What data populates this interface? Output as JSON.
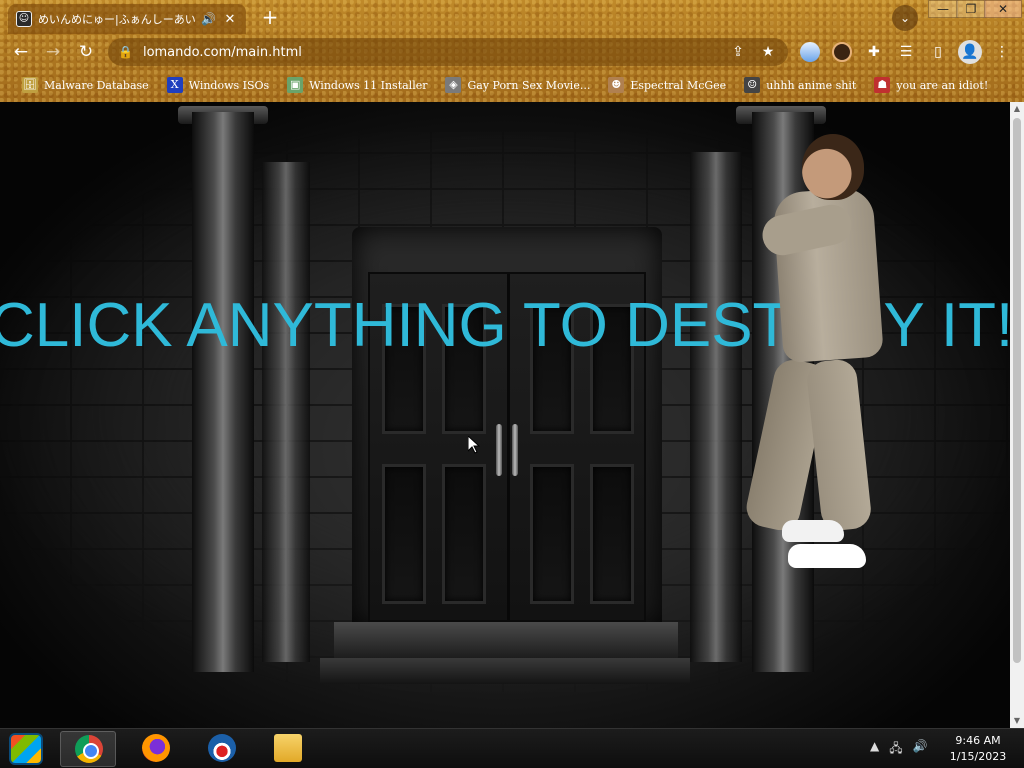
{
  "browser": {
    "tab": {
      "title": "めいんめにゅー|ふぁんしーあいらんど",
      "favicon": "anime-girl-icon",
      "audio_icon": "🔊",
      "close_icon": "✕"
    },
    "new_tab_icon": "+",
    "tab_search_icon": "⌄",
    "window_controls": {
      "minimize": "—",
      "maximize": "❐",
      "close": "✕"
    },
    "nav": {
      "back": "←",
      "forward": "→",
      "reload": "↻"
    },
    "address": {
      "url": "lomando.com/main.html",
      "lock_icon": "🔒",
      "share_icon": "⇪",
      "star_icon": "★"
    },
    "extensions": [
      "globe-extension-icon",
      "avatar-extension-icon",
      "puzzle-icon",
      "playlist-icon",
      "side-panel-icon"
    ],
    "profile_icon": "👤",
    "menu_icon": "⋮",
    "bookmarks": [
      {
        "label": "Malware Database",
        "icon": "🗄",
        "color": "#c0a040"
      },
      {
        "label": "Windows ISOs",
        "icon": "X",
        "color": "#1f3fbf"
      },
      {
        "label": "Windows 11 Installer",
        "icon": "▣",
        "color": "#6aa36a"
      },
      {
        "label": "Gay Porn Sex Movie...",
        "icon": "◈",
        "color": "#7a7a7a"
      },
      {
        "label": "Espectral McGee",
        "icon": "☻",
        "color": "#b08050"
      },
      {
        "label": "uhhh anime shit",
        "icon": "☺",
        "color": "#444444"
      },
      {
        "label": "you are an idiot!",
        "icon": "☗",
        "color": "#c03030"
      }
    ]
  },
  "page": {
    "headline": "CLICK ANYTHING TO DESTROY IT!!",
    "headline_color": "#2fb9d8"
  },
  "taskbar": {
    "apps": [
      "start-orb",
      "chrome",
      "firefox",
      "obama-logo",
      "file-explorer"
    ],
    "tray": {
      "chevron": "▲",
      "network": "🖧",
      "volume": "🔊"
    },
    "clock": {
      "time": "9:46 AM",
      "date": "1/15/2023"
    }
  }
}
